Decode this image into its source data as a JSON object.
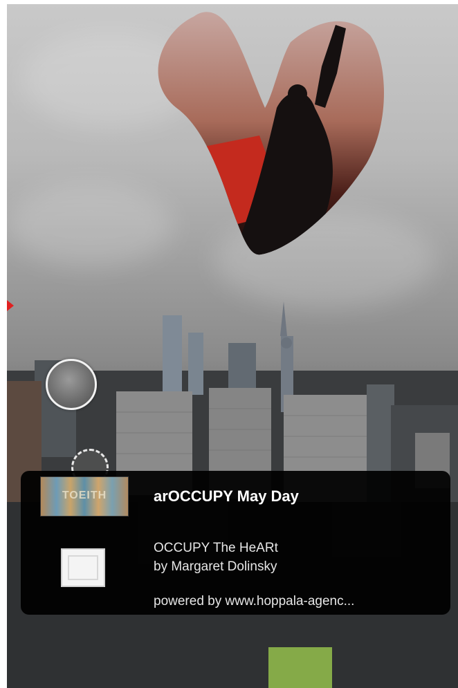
{
  "info_panel": {
    "title": "arOCCUPY May Day",
    "thumbnail_text": "TOEITH",
    "description_line1": "OCCUPY The HeARt",
    "description_line2": "by Margaret Dolinsky",
    "powered_by": "powered by www.hoppala-agenc..."
  },
  "icons": {
    "image_placeholder": "image-icon",
    "poi_marker": "poi-circle-icon",
    "red_marker": "triangle-marker-icon"
  },
  "colors": {
    "panel_bg": "#000000",
    "heart_red": "#c42a1e",
    "marker_red": "#e02020"
  }
}
